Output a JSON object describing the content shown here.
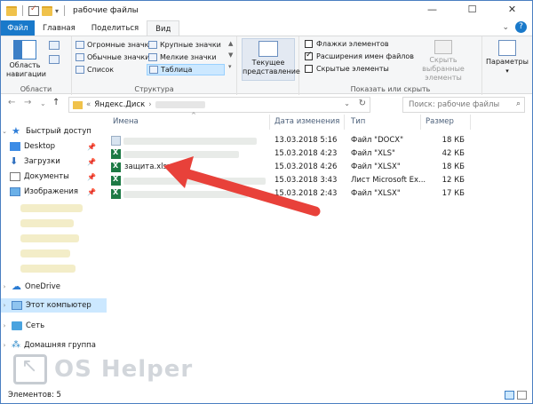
{
  "window": {
    "title": "рабочие файлы",
    "controls": {
      "minimize": "—",
      "maximize": "☐",
      "close": "✕"
    }
  },
  "tabs": [
    "Файл",
    "Главная",
    "Поделиться",
    "Вид"
  ],
  "active_tab": "Вид",
  "ribbon": {
    "panes": {
      "nav_area_label": "Область навигации",
      "group_label": "Области"
    },
    "layout": {
      "items": [
        "Огромные значки",
        "Обычные значки",
        "Список",
        "Крупные значки",
        "Мелкие значки",
        "Таблица"
      ],
      "selected": "Таблица",
      "group_label": "Структура"
    },
    "current_view": {
      "label": "Текущее представление",
      "group_label": ""
    },
    "show_hide": {
      "checkboxes": [
        {
          "label": "Флажки элементов",
          "checked": false
        },
        {
          "label": "Расширения имен файлов",
          "checked": true
        },
        {
          "label": "Скрытые элементы",
          "checked": false
        }
      ],
      "hide_selected_label": "Скрыть выбранные элементы",
      "group_label": "Показать или скрыть"
    },
    "options_label": "Параметры"
  },
  "address": {
    "path_root": "Яндекс.Диск",
    "search_placeholder": "Поиск: рабочие файлы"
  },
  "nav_pane": {
    "quick_access": "Быстрый доступ",
    "items": [
      "Desktop",
      "Загрузки",
      "Документы",
      "Изображения"
    ],
    "onedrive": "OneDrive",
    "this_pc": "Этот компьютер",
    "network": "Сеть",
    "homegroup": "Домашняя группа"
  },
  "columns": [
    "Имена",
    "Дата изменения",
    "Тип",
    "Размер"
  ],
  "files": [
    {
      "name": "",
      "date": "13.03.2018 5:16",
      "type": "Файл \"DOCX\"",
      "size": "18 КБ",
      "icon": "doc"
    },
    {
      "name": "",
      "date": "15.03.2018 4:23",
      "type": "Файл \"XLS\"",
      "size": "42 КБ",
      "icon": "xls"
    },
    {
      "name": "защита.xlsx",
      "date": "15.03.2018 4:26",
      "type": "Файл \"XLSX\"",
      "size": "18 КБ",
      "icon": "xls"
    },
    {
      "name": "",
      "date": "15.03.2018 3:43",
      "type": "Лист Microsoft Ex...",
      "size": "12 КБ",
      "icon": "xls"
    },
    {
      "name": "",
      "date": "15.03.2018 2:43",
      "type": "Файл \"XLSX\"",
      "size": "17 КБ",
      "icon": "xls"
    }
  ],
  "status": {
    "count": "Элементов: 5"
  },
  "watermark": "OS Helper",
  "colors": {
    "accent": "#1979ca",
    "selected": "#cce8ff",
    "arrow": "#e8413a"
  }
}
